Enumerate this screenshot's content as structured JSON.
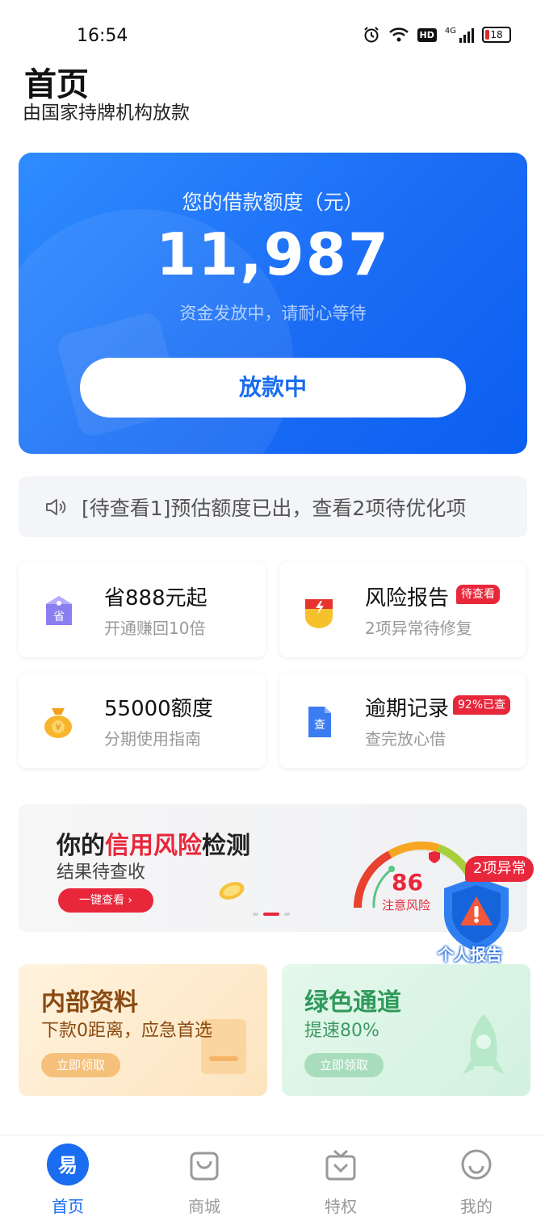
{
  "status_bar": {
    "time": "16:54",
    "battery": "18",
    "network": "4G",
    "hd": "HD"
  },
  "header": {
    "title": "首页",
    "subtitle": "由国家持牌机构放款"
  },
  "hero": {
    "label": "您的借款额度（元）",
    "amount": "11,987",
    "hint": "资金发放中，请耐心等待",
    "button": "放款中"
  },
  "notice": {
    "text": "[待查看1]预估额度已出，查看2项待优化项",
    "icon": "speaker-icon"
  },
  "cards": [
    {
      "title": "省888元起",
      "sub": "开通赚回10倍",
      "icon": "coupon-tag-icon",
      "icon_text": "省"
    },
    {
      "title": "风险报告",
      "sub": "2项异常待修复",
      "tag": "待查看",
      "icon": "warning-shield-icon"
    },
    {
      "title": "55000额度",
      "sub": "分期使用指南",
      "icon": "money-bag-icon",
      "icon_text": "¥"
    },
    {
      "title": "逾期记录",
      "sub": "查完放心借",
      "tag": "92%已查",
      "icon": "document-check-icon",
      "icon_text": "查"
    }
  ],
  "banner": {
    "title_pre": "你的",
    "title_red": "信用风险",
    "title_post": "检测",
    "sub": "结果待查收",
    "button": "一键查看 ›",
    "score": "86",
    "level": "注意风险"
  },
  "report_float": {
    "badge": "2项异常",
    "label": "个人报告"
  },
  "promos": [
    {
      "title": "内部资料",
      "desc": "下款0距离，应急首选",
      "button": "立即领取",
      "color": "#f5a54a"
    },
    {
      "title": "绿色通道",
      "desc": "提速80%",
      "button": "立即领取",
      "color": "#5cc486"
    }
  ],
  "tabs": [
    {
      "label": "首页",
      "active": true,
      "icon": "home-icon",
      "icon_text": "易"
    },
    {
      "label": "商城",
      "active": false,
      "icon": "shopping-bag-icon"
    },
    {
      "label": "特权",
      "active": false,
      "icon": "privilege-icon"
    },
    {
      "label": "我的",
      "active": false,
      "icon": "profile-icon"
    }
  ],
  "colors": {
    "primary": "#1a6cf0",
    "accent_red": "#e8273b"
  }
}
